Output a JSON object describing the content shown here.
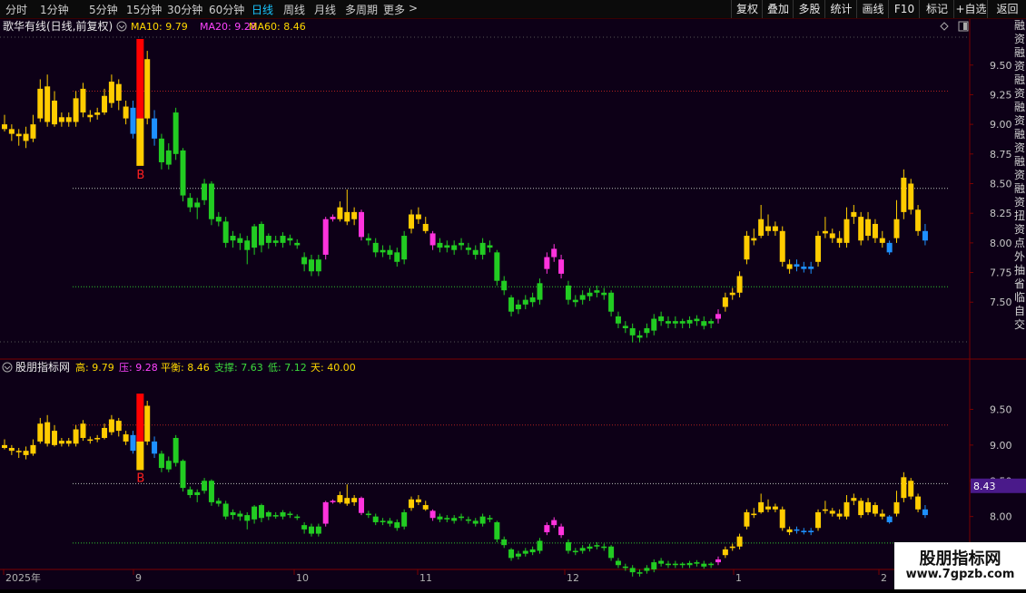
{
  "toolbar": {
    "periods": [
      {
        "label": "分时",
        "active": false
      },
      {
        "label": "1分钟",
        "active": false
      },
      {
        "label": "5分钟",
        "active": false
      },
      {
        "label": "15分钟",
        "active": false
      },
      {
        "label": "30分钟",
        "active": false
      },
      {
        "label": "60分钟",
        "active": false
      },
      {
        "label": "日线",
        "active": true
      },
      {
        "label": "周线",
        "active": false
      },
      {
        "label": "月线",
        "active": false
      },
      {
        "label": "多周期",
        "active": false
      },
      {
        "label": "更多",
        "active": false
      }
    ],
    "more_arrow": ">",
    "right_buttons": [
      "复权",
      "叠加",
      "多股",
      "统计",
      "画线",
      "F10",
      "标记",
      "+自选",
      "返回"
    ]
  },
  "upper": {
    "title": "歌华有线(日线,前复权)",
    "ma": [
      {
        "label": "MA10: 9.79",
        "color": "#ffd800"
      },
      {
        "label": "MA20: 9.28",
        "color": "#ff44ff"
      },
      {
        "label": "MA60: 8.46",
        "color": "#ffd800"
      }
    ],
    "y_ticks": [
      "9.50",
      "9.25",
      "9.00",
      "8.75",
      "8.50",
      "8.25",
      "8.00",
      "7.75",
      "7.50"
    ],
    "signal": "B"
  },
  "lower": {
    "title": "股朋指标网",
    "legend": [
      {
        "label": "高: 9.79",
        "color": "#ffd800"
      },
      {
        "label": "压: 9.28",
        "color": "#ff44ff"
      },
      {
        "label": "平衡: 8.46",
        "color": "#ffd800"
      },
      {
        "label": "支撑: 7.63",
        "color": "#3ddc3d"
      },
      {
        "label": "低: 7.12",
        "color": "#3ddc3d"
      },
      {
        "label": "天: 40.00",
        "color": "#ffd800"
      }
    ],
    "y_ticks": [
      "9.50",
      "9.00",
      "8.50",
      "8.00",
      "7.50"
    ],
    "price_tag": "8.43",
    "signal": "B"
  },
  "date_axis": [
    "2025年",
    "9",
    "10",
    "11",
    "12",
    "1",
    "2"
  ],
  "right_strip": [
    "融",
    "资",
    "融",
    "资",
    "融",
    "资",
    "融",
    "资",
    "融",
    "资",
    "融",
    "资",
    "融",
    "资",
    "扭",
    "资",
    "点",
    "外",
    "抽",
    "省",
    "临",
    "自",
    "交"
  ],
  "watermark": {
    "line1": "股朋指标网",
    "line2": "www.7gpzb.com"
  },
  "colors": {
    "up": "#ffcc00",
    "down": "#22cc22",
    "magenta": "#ff33dd",
    "blue": "#1e90ff",
    "signal_red": "#ff0000"
  },
  "chart_data": {
    "type": "candlestick",
    "levels": {
      "high": 9.79,
      "pressure": 9.28,
      "balance": 8.46,
      "support": 7.63,
      "low": 7.12
    },
    "ylim_upper": [
      7.15,
      9.72
    ],
    "ylim_lower": [
      7.45,
      9.95
    ],
    "candles": [
      {
        "o": 8.96,
        "c": 9.0,
        "h": 9.08,
        "l": 8.94,
        "k": "y"
      },
      {
        "o": 8.92,
        "c": 8.96,
        "h": 9.0,
        "l": 8.86,
        "k": "y"
      },
      {
        "o": 8.9,
        "c": 8.92,
        "h": 8.96,
        "l": 8.82,
        "k": "y"
      },
      {
        "o": 8.86,
        "c": 8.92,
        "h": 8.98,
        "l": 8.8,
        "k": "y"
      },
      {
        "o": 8.88,
        "c": 9.0,
        "h": 9.08,
        "l": 8.85,
        "k": "y"
      },
      {
        "o": 9.05,
        "c": 9.3,
        "h": 9.38,
        "l": 9.02,
        "k": "y"
      },
      {
        "o": 9.02,
        "c": 9.32,
        "h": 9.42,
        "l": 8.98,
        "k": "y"
      },
      {
        "o": 9.0,
        "c": 9.2,
        "h": 9.28,
        "l": 8.98,
        "k": "y"
      },
      {
        "o": 9.02,
        "c": 9.06,
        "h": 9.1,
        "l": 8.98,
        "k": "y"
      },
      {
        "o": 9.02,
        "c": 9.06,
        "h": 9.1,
        "l": 8.98,
        "k": "y"
      },
      {
        "o": 9.02,
        "c": 9.22,
        "h": 9.28,
        "l": 8.98,
        "k": "y"
      },
      {
        "o": 9.1,
        "c": 9.3,
        "h": 9.35,
        "l": 9.06,
        "k": "y"
      },
      {
        "o": 9.06,
        "c": 9.08,
        "h": 9.12,
        "l": 9.02,
        "k": "y"
      },
      {
        "o": 9.08,
        "c": 9.1,
        "h": 9.14,
        "l": 9.04,
        "k": "y"
      },
      {
        "o": 9.1,
        "c": 9.24,
        "h": 9.3,
        "l": 9.08,
        "k": "y"
      },
      {
        "o": 9.18,
        "c": 9.36,
        "h": 9.42,
        "l": 9.14,
        "k": "y"
      },
      {
        "o": 9.2,
        "c": 9.34,
        "h": 9.38,
        "l": 9.12,
        "k": "y"
      },
      {
        "o": 9.05,
        "c": 9.15,
        "h": 9.2,
        "l": 9.0,
        "k": "y"
      },
      {
        "o": 9.14,
        "c": 8.92,
        "h": 9.2,
        "l": 8.88,
        "k": "b"
      },
      {
        "o": 8.65,
        "c": 9.72,
        "h": 9.72,
        "l": 8.65,
        "k": "s"
      },
      {
        "o": 9.05,
        "c": 9.55,
        "h": 9.62,
        "l": 9.0,
        "k": "y"
      },
      {
        "o": 9.05,
        "c": 8.88,
        "h": 9.12,
        "l": 8.82,
        "k": "b"
      },
      {
        "o": 8.88,
        "c": 8.68,
        "h": 8.92,
        "l": 8.62,
        "k": "g"
      },
      {
        "o": 8.78,
        "c": 8.66,
        "h": 8.84,
        "l": 8.62,
        "k": "g"
      },
      {
        "o": 9.1,
        "c": 8.75,
        "h": 9.14,
        "l": 8.7,
        "k": "g"
      },
      {
        "o": 8.78,
        "c": 8.4,
        "h": 8.8,
        "l": 8.35,
        "k": "g"
      },
      {
        "o": 8.38,
        "c": 8.3,
        "h": 8.42,
        "l": 8.26,
        "k": "g"
      },
      {
        "o": 8.34,
        "c": 8.3,
        "h": 8.38,
        "l": 8.2,
        "k": "g"
      },
      {
        "o": 8.5,
        "c": 8.36,
        "h": 8.54,
        "l": 8.32,
        "k": "g"
      },
      {
        "o": 8.5,
        "c": 8.2,
        "h": 8.52,
        "l": 8.15,
        "k": "g"
      },
      {
        "o": 8.22,
        "c": 8.18,
        "h": 8.26,
        "l": 8.14,
        "k": "g"
      },
      {
        "o": 8.18,
        "c": 8.0,
        "h": 8.22,
        "l": 7.96,
        "k": "g"
      },
      {
        "o": 8.06,
        "c": 8.02,
        "h": 8.1,
        "l": 7.96,
        "k": "g"
      },
      {
        "o": 8.04,
        "c": 8.0,
        "h": 8.08,
        "l": 7.94,
        "k": "g"
      },
      {
        "o": 8.02,
        "c": 7.94,
        "h": 8.06,
        "l": 7.82,
        "k": "g"
      },
      {
        "o": 8.14,
        "c": 7.96,
        "h": 8.16,
        "l": 7.9,
        "k": "g"
      },
      {
        "o": 8.16,
        "c": 7.98,
        "h": 8.18,
        "l": 7.92,
        "k": "g"
      },
      {
        "o": 8.06,
        "c": 8.0,
        "h": 8.08,
        "l": 7.95,
        "k": "g"
      },
      {
        "o": 8.02,
        "c": 8.0,
        "h": 8.06,
        "l": 7.97,
        "k": "g"
      },
      {
        "o": 8.06,
        "c": 8.0,
        "h": 8.09,
        "l": 7.96,
        "k": "g"
      },
      {
        "o": 8.04,
        "c": 8.02,
        "h": 8.07,
        "l": 7.98,
        "k": "g"
      },
      {
        "o": 8.0,
        "c": 7.98,
        "h": 8.03,
        "l": 7.95,
        "k": "g"
      },
      {
        "o": 7.88,
        "c": 7.82,
        "h": 7.92,
        "l": 7.76,
        "k": "g"
      },
      {
        "o": 7.86,
        "c": 7.76,
        "h": 7.9,
        "l": 7.72,
        "k": "g"
      },
      {
        "o": 7.86,
        "c": 7.76,
        "h": 7.9,
        "l": 7.72,
        "k": "g"
      },
      {
        "o": 7.9,
        "c": 8.2,
        "h": 8.22,
        "l": 7.86,
        "k": "m"
      },
      {
        "o": 8.2,
        "c": 8.22,
        "h": 8.24,
        "l": 8.18,
        "k": "m"
      },
      {
        "o": 8.2,
        "c": 8.3,
        "h": 8.35,
        "l": 8.18,
        "k": "y"
      },
      {
        "o": 8.18,
        "c": 8.26,
        "h": 8.45,
        "l": 8.15,
        "k": "y"
      },
      {
        "o": 8.2,
        "c": 8.26,
        "h": 8.3,
        "l": 8.15,
        "k": "y"
      },
      {
        "o": 8.26,
        "c": 8.05,
        "h": 8.28,
        "l": 8.02,
        "k": "m"
      },
      {
        "o": 8.04,
        "c": 8.02,
        "h": 8.08,
        "l": 7.98,
        "k": "g"
      },
      {
        "o": 8.0,
        "c": 7.92,
        "h": 8.04,
        "l": 7.88,
        "k": "g"
      },
      {
        "o": 7.94,
        "c": 7.92,
        "h": 7.98,
        "l": 7.88,
        "k": "g"
      },
      {
        "o": 7.94,
        "c": 7.9,
        "h": 7.98,
        "l": 7.86,
        "k": "g"
      },
      {
        "o": 7.92,
        "c": 7.84,
        "h": 7.96,
        "l": 7.8,
        "k": "g"
      },
      {
        "o": 7.86,
        "c": 8.06,
        "h": 8.1,
        "l": 7.82,
        "k": "g"
      },
      {
        "o": 8.12,
        "c": 8.24,
        "h": 8.28,
        "l": 8.08,
        "k": "y"
      },
      {
        "o": 8.2,
        "c": 8.24,
        "h": 8.3,
        "l": 8.16,
        "k": "y"
      },
      {
        "o": 8.16,
        "c": 8.1,
        "h": 8.22,
        "l": 8.08,
        "k": "y"
      },
      {
        "o": 8.08,
        "c": 7.98,
        "h": 8.1,
        "l": 7.94,
        "k": "m"
      },
      {
        "o": 8.0,
        "c": 7.96,
        "h": 8.04,
        "l": 7.92,
        "k": "g"
      },
      {
        "o": 7.98,
        "c": 7.96,
        "h": 8.02,
        "l": 7.92,
        "k": "g"
      },
      {
        "o": 7.98,
        "c": 7.94,
        "h": 8.02,
        "l": 7.9,
        "k": "g"
      },
      {
        "o": 7.98,
        "c": 8.0,
        "h": 8.04,
        "l": 7.94,
        "k": "g"
      },
      {
        "o": 7.96,
        "c": 7.94,
        "h": 8.0,
        "l": 7.9,
        "k": "g"
      },
      {
        "o": 7.94,
        "c": 7.9,
        "h": 7.98,
        "l": 7.86,
        "k": "g"
      },
      {
        "o": 7.9,
        "c": 8.0,
        "h": 8.04,
        "l": 7.86,
        "k": "g"
      },
      {
        "o": 7.96,
        "c": 7.98,
        "h": 8.02,
        "l": 7.92,
        "k": "g"
      },
      {
        "o": 7.92,
        "c": 7.68,
        "h": 7.94,
        "l": 7.64,
        "k": "g"
      },
      {
        "o": 7.68,
        "c": 7.6,
        "h": 7.72,
        "l": 7.56,
        "k": "g"
      },
      {
        "o": 7.54,
        "c": 7.42,
        "h": 7.56,
        "l": 7.38,
        "k": "g"
      },
      {
        "o": 7.44,
        "c": 7.48,
        "h": 7.52,
        "l": 7.4,
        "k": "g"
      },
      {
        "o": 7.48,
        "c": 7.52,
        "h": 7.56,
        "l": 7.44,
        "k": "g"
      },
      {
        "o": 7.5,
        "c": 7.54,
        "h": 7.58,
        "l": 7.46,
        "k": "g"
      },
      {
        "o": 7.52,
        "c": 7.66,
        "h": 7.7,
        "l": 7.48,
        "k": "g"
      },
      {
        "o": 7.78,
        "c": 7.88,
        "h": 7.92,
        "l": 7.74,
        "k": "m"
      },
      {
        "o": 7.88,
        "c": 7.95,
        "h": 7.99,
        "l": 7.84,
        "k": "m"
      },
      {
        "o": 7.86,
        "c": 7.74,
        "h": 7.9,
        "l": 7.7,
        "k": "m"
      },
      {
        "o": 7.64,
        "c": 7.52,
        "h": 7.68,
        "l": 7.48,
        "k": "g"
      },
      {
        "o": 7.52,
        "c": 7.5,
        "h": 7.56,
        "l": 7.46,
        "k": "g"
      },
      {
        "o": 7.52,
        "c": 7.56,
        "h": 7.6,
        "l": 7.48,
        "k": "g"
      },
      {
        "o": 7.55,
        "c": 7.58,
        "h": 7.62,
        "l": 7.51,
        "k": "g"
      },
      {
        "o": 7.58,
        "c": 7.6,
        "h": 7.64,
        "l": 7.54,
        "k": "g"
      },
      {
        "o": 7.56,
        "c": 7.58,
        "h": 7.62,
        "l": 7.52,
        "k": "g"
      },
      {
        "o": 7.58,
        "c": 7.42,
        "h": 7.6,
        "l": 7.38,
        "k": "g"
      },
      {
        "o": 7.38,
        "c": 7.32,
        "h": 7.42,
        "l": 7.28,
        "k": "g"
      },
      {
        "o": 7.3,
        "c": 7.28,
        "h": 7.34,
        "l": 7.24,
        "k": "g"
      },
      {
        "o": 7.28,
        "c": 7.22,
        "h": 7.32,
        "l": 7.16,
        "k": "g"
      },
      {
        "o": 7.22,
        "c": 7.2,
        "h": 7.26,
        "l": 7.16,
        "k": "g"
      },
      {
        "o": 7.24,
        "c": 7.28,
        "h": 7.32,
        "l": 7.2,
        "k": "g"
      },
      {
        "o": 7.26,
        "c": 7.36,
        "h": 7.4,
        "l": 7.22,
        "k": "g"
      },
      {
        "o": 7.34,
        "c": 7.38,
        "h": 7.42,
        "l": 7.3,
        "k": "g"
      },
      {
        "o": 7.34,
        "c": 7.32,
        "h": 7.38,
        "l": 7.28,
        "k": "g"
      },
      {
        "o": 7.32,
        "c": 7.34,
        "h": 7.38,
        "l": 7.28,
        "k": "g"
      },
      {
        "o": 7.34,
        "c": 7.32,
        "h": 7.36,
        "l": 7.28,
        "k": "g"
      },
      {
        "o": 7.32,
        "c": 7.35,
        "h": 7.38,
        "l": 7.28,
        "k": "g"
      },
      {
        "o": 7.34,
        "c": 7.36,
        "h": 7.39,
        "l": 7.3,
        "k": "g"
      },
      {
        "o": 7.3,
        "c": 7.34,
        "h": 7.38,
        "l": 7.27,
        "k": "g"
      },
      {
        "o": 7.32,
        "c": 7.34,
        "h": 7.36,
        "l": 7.28,
        "k": "g"
      },
      {
        "o": 7.36,
        "c": 7.4,
        "h": 7.44,
        "l": 7.32,
        "k": "m"
      },
      {
        "o": 7.46,
        "c": 7.54,
        "h": 7.58,
        "l": 7.42,
        "k": "y"
      },
      {
        "o": 7.56,
        "c": 7.58,
        "h": 7.62,
        "l": 7.52,
        "k": "y"
      },
      {
        "o": 7.58,
        "c": 7.72,
        "h": 7.76,
        "l": 7.54,
        "k": "y"
      },
      {
        "o": 7.86,
        "c": 8.06,
        "h": 8.1,
        "l": 7.82,
        "k": "y"
      },
      {
        "o": 8.02,
        "c": 8.04,
        "h": 8.12,
        "l": 7.98,
        "k": "y"
      },
      {
        "o": 8.06,
        "c": 8.2,
        "h": 8.32,
        "l": 8.04,
        "k": "y"
      },
      {
        "o": 8.1,
        "c": 8.14,
        "h": 8.24,
        "l": 8.06,
        "k": "y"
      },
      {
        "o": 8.1,
        "c": 8.14,
        "h": 8.18,
        "l": 8.06,
        "k": "y"
      },
      {
        "o": 8.1,
        "c": 7.84,
        "h": 8.14,
        "l": 7.8,
        "k": "y"
      },
      {
        "o": 7.82,
        "c": 7.78,
        "h": 7.86,
        "l": 7.74,
        "k": "y"
      },
      {
        "o": 7.82,
        "c": 7.8,
        "h": 7.86,
        "l": 7.76,
        "k": "b"
      },
      {
        "o": 7.8,
        "c": 7.78,
        "h": 7.84,
        "l": 7.75,
        "k": "b"
      },
      {
        "o": 7.8,
        "c": 7.78,
        "h": 7.84,
        "l": 7.74,
        "k": "b"
      },
      {
        "o": 7.84,
        "c": 8.06,
        "h": 8.1,
        "l": 7.8,
        "k": "y"
      },
      {
        "o": 8.08,
        "c": 8.1,
        "h": 8.22,
        "l": 8.04,
        "k": "y"
      },
      {
        "o": 8.04,
        "c": 8.08,
        "h": 8.12,
        "l": 8.0,
        "k": "y"
      },
      {
        "o": 8.0,
        "c": 8.04,
        "h": 8.1,
        "l": 7.96,
        "k": "y"
      },
      {
        "o": 8.0,
        "c": 8.2,
        "h": 8.3,
        "l": 7.96,
        "k": "y"
      },
      {
        "o": 8.22,
        "c": 8.26,
        "h": 8.32,
        "l": 8.16,
        "k": "y"
      },
      {
        "o": 8.02,
        "c": 8.22,
        "h": 8.26,
        "l": 7.98,
        "k": "y"
      },
      {
        "o": 8.06,
        "c": 8.2,
        "h": 8.26,
        "l": 8.02,
        "k": "y"
      },
      {
        "o": 8.04,
        "c": 8.16,
        "h": 8.2,
        "l": 8.0,
        "k": "y"
      },
      {
        "o": 8.04,
        "c": 8.0,
        "h": 8.1,
        "l": 7.96,
        "k": "y"
      },
      {
        "o": 8.0,
        "c": 7.92,
        "h": 8.02,
        "l": 7.9,
        "k": "b"
      },
      {
        "o": 8.04,
        "c": 8.2,
        "h": 8.36,
        "l": 8.0,
        "k": "y"
      },
      {
        "o": 8.26,
        "c": 8.55,
        "h": 8.62,
        "l": 8.2,
        "k": "y"
      },
      {
        "o": 8.28,
        "c": 8.5,
        "h": 8.54,
        "l": 8.24,
        "k": "y"
      },
      {
        "o": 8.1,
        "c": 8.28,
        "h": 8.32,
        "l": 8.06,
        "k": "y"
      },
      {
        "o": 8.1,
        "c": 8.02,
        "h": 8.16,
        "l": 7.98,
        "k": "b"
      }
    ]
  }
}
